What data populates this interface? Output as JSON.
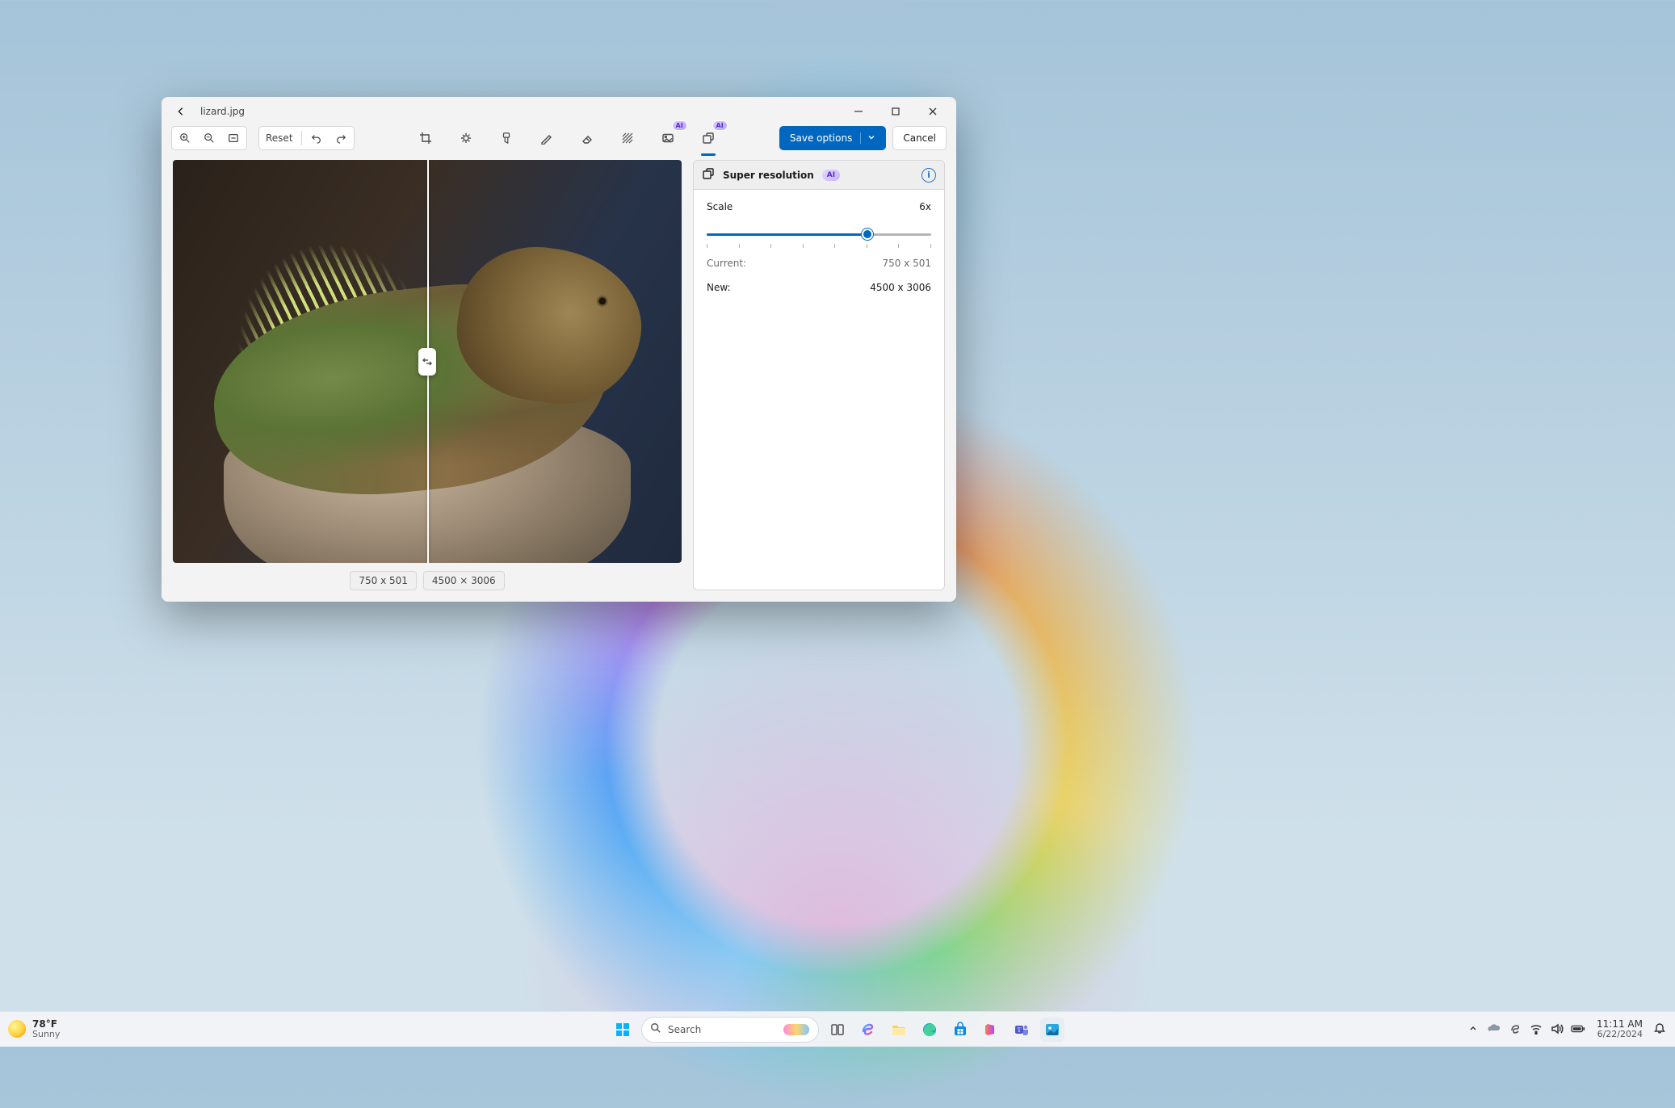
{
  "titlebar": {
    "filename": "lizard.jpg"
  },
  "toolbar": {
    "reset_label": "Reset",
    "ai_badge": "AI",
    "save_label": "Save options",
    "cancel_label": "Cancel"
  },
  "canvas": {
    "pills": {
      "left": "750 x 501",
      "right": "4500 × 3006"
    }
  },
  "panel": {
    "title": "Super resolution",
    "badge": "AI",
    "scale_label": "Scale",
    "scale_value": "6x",
    "slider": {
      "min": 1,
      "max": 8,
      "value": 6,
      "ticks": 8
    },
    "current_label": "Current:",
    "current_value": "750 x 501",
    "new_label": "New:",
    "new_value": "4500 x 3006"
  },
  "taskbar": {
    "weather": {
      "temp": "78°F",
      "cond": "Sunny"
    },
    "search_placeholder": "Search",
    "clock": {
      "time": "11:11 AM",
      "date": "6/22/2024"
    }
  }
}
